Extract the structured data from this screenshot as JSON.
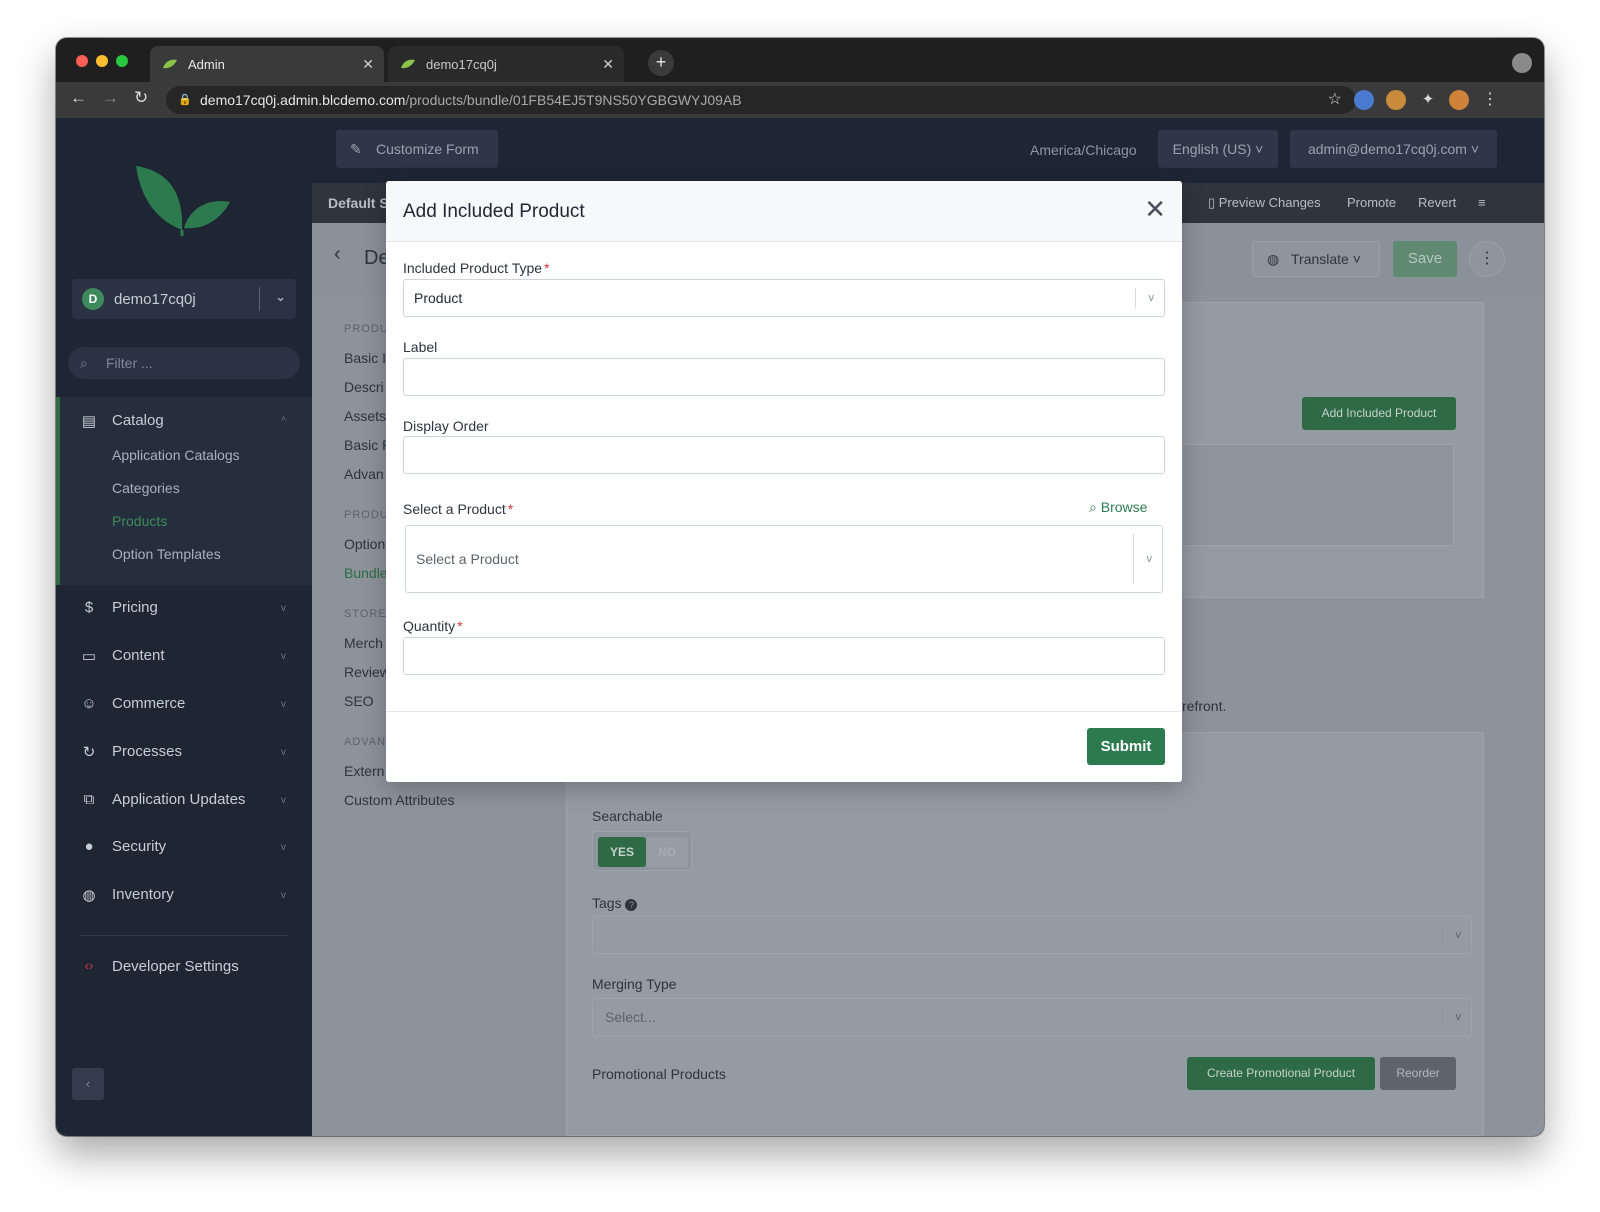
{
  "browser": {
    "tabs": [
      {
        "label": "Admin",
        "active": true
      },
      {
        "label": "demo17cq0j",
        "active": false
      }
    ],
    "url_host": "demo17cq0j.admin.blcdemo.com",
    "url_path": "/products/bundle/01FB54EJ5T9NS50YGBGWYJ09AB"
  },
  "sidebar": {
    "tenant_initial": "D",
    "tenant_name": "demo17cq0j",
    "filter_placeholder": "Filter ...",
    "catalog_label": "Catalog",
    "catalog_items": [
      "Application Catalogs",
      "Categories",
      "Products",
      "Option Templates"
    ],
    "sections": [
      "Pricing",
      "Content",
      "Commerce",
      "Processes",
      "Application Updates",
      "Security",
      "Inventory"
    ],
    "developer_label": "Developer Settings"
  },
  "topbar": {
    "customize_label": "Customize Form",
    "timezone": "America/Chicago",
    "language": "English (US)",
    "user": "admin@demo17cq0j.com"
  },
  "context_bar": {
    "left_label": "Default S",
    "preview": "Preview Changes",
    "promote": "Promote",
    "revert": "Revert"
  },
  "entity": {
    "title": "De",
    "translate": "Translate",
    "save": "Save"
  },
  "form_nav": {
    "h1": "PRODU",
    "g1": [
      "Basic I",
      "Descri",
      "Assets",
      "Basic P",
      "Advan"
    ],
    "h2": "PRODU",
    "g2": [
      "Option",
      "Bundle"
    ],
    "h3": "STORE",
    "g3": [
      "Merch",
      "Review",
      "SEO"
    ],
    "h4": "ADVAN",
    "g4": [
      "Extern",
      "Custom Attributes"
    ]
  },
  "background": {
    "add_included_product": "Add Included Product",
    "storefront_fragment": "refront.",
    "searchable_label": "Searchable",
    "toggle_yes": "YES",
    "toggle_no": "NO",
    "tags_label": "Tags",
    "merging_type_label": "Merging Type",
    "merging_type_placeholder": "Select...",
    "promotional_label": "Promotional Products",
    "create_promo": "Create Promotional Product",
    "reorder": "Reorder"
  },
  "modal": {
    "title": "Add Included Product",
    "type_label": "Included Product Type",
    "type_value": "Product",
    "label_label": "Label",
    "label_value": "",
    "order_label": "Display Order",
    "order_value": "",
    "product_label": "Select a Product",
    "browse": "Browse",
    "product_placeholder": "Select a Product",
    "quantity_label": "Quantity",
    "quantity_value": "",
    "submit": "Submit"
  },
  "colors": {
    "accent_green": "#2e7a4f",
    "sidebar_bg": "#1e2634",
    "required": "#d0353f"
  }
}
